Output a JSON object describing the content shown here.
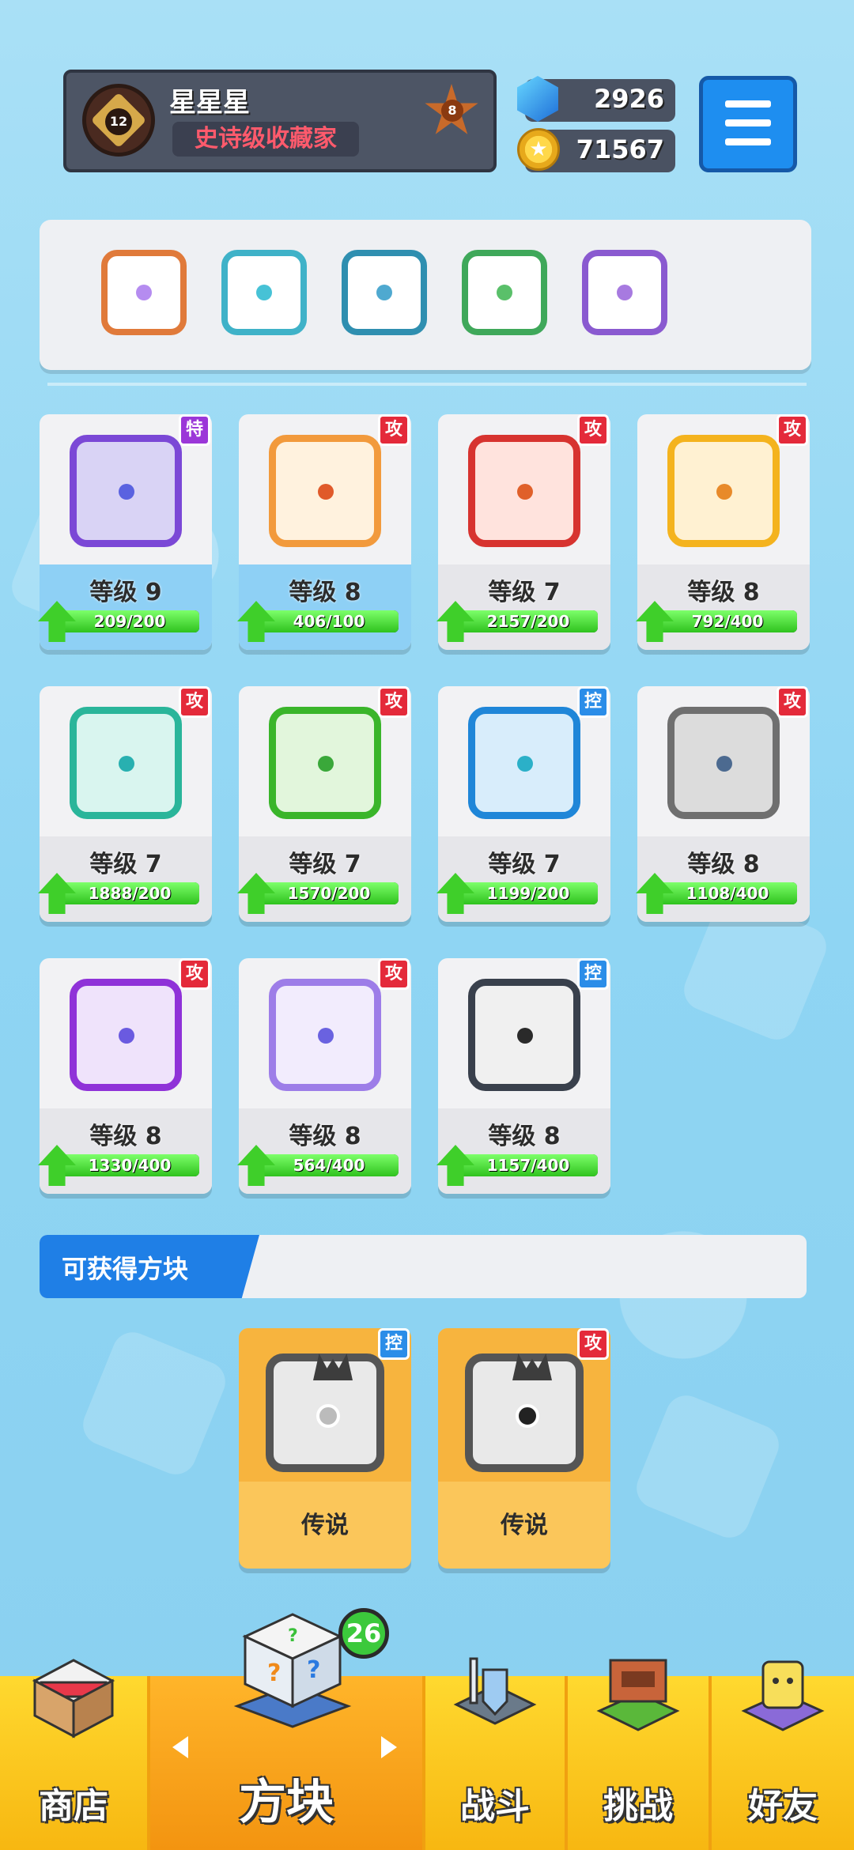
{
  "profile": {
    "name": "星星星",
    "title": "史诗级收藏家",
    "level": "12",
    "rank": "8"
  },
  "currency": {
    "gems": "2926",
    "coins": "71567"
  },
  "deck": [
    {
      "name": "rainbow",
      "border": "#e07a3a",
      "core": "#b58cf0"
    },
    {
      "name": "ice",
      "border": "#3fb2c8",
      "core": "#47c2d6"
    },
    {
      "name": "vortex",
      "border": "#2f8fb0",
      "core": "#4fa9d0"
    },
    {
      "name": "poison",
      "border": "#3fa85a",
      "core": "#5ac06a"
    },
    {
      "name": "spirit",
      "border": "#8a5ad0",
      "core": "#a77ae0"
    }
  ],
  "cards": [
    {
      "type": "特",
      "kind": "sp",
      "level": "等级 9",
      "progress": "209/200",
      "pct": 1.0,
      "border": "#7b48d6",
      "bg": "#d9d3f5",
      "dot": "#5a62e0",
      "hl": true
    },
    {
      "type": "攻",
      "kind": "atk",
      "level": "等级 8",
      "progress": "406/100",
      "pct": 1.0,
      "border": "#f29a3c",
      "bg": "#fff2de",
      "dot": "#e05a2a",
      "hl": true
    },
    {
      "type": "攻",
      "kind": "atk",
      "level": "等级 7",
      "progress": "2157/200",
      "pct": 1.0,
      "border": "#d7332f",
      "bg": "#ffe3dd",
      "dot": "#e0602a",
      "hl": false
    },
    {
      "type": "攻",
      "kind": "atk",
      "level": "等级 8",
      "progress": "792/400",
      "pct": 1.0,
      "border": "#f4b31e",
      "bg": "#fff1d2",
      "dot": "#e88a2a",
      "hl": false
    },
    {
      "type": "攻",
      "kind": "atk",
      "level": "等级 7",
      "progress": "1888/200",
      "pct": 1.0,
      "border": "#2ab59a",
      "bg": "#d9f5ef",
      "dot": "#28b0b0",
      "hl": false
    },
    {
      "type": "攻",
      "kind": "atk",
      "level": "等级 7",
      "progress": "1570/200",
      "pct": 1.0,
      "border": "#3ab52a",
      "bg": "#e2f6dc",
      "dot": "#3aa83a",
      "hl": false
    },
    {
      "type": "控",
      "kind": "ctl",
      "level": "等级 7",
      "progress": "1199/200",
      "pct": 1.0,
      "border": "#1f86d8",
      "bg": "#d8edfb",
      "dot": "#2bb0c8",
      "hl": false
    },
    {
      "type": "攻",
      "kind": "atk",
      "level": "等级 8",
      "progress": "1108/400",
      "pct": 1.0,
      "border": "#6f6f6f",
      "bg": "#dcdcdc",
      "dot": "#4c6a90",
      "hl": false
    },
    {
      "type": "攻",
      "kind": "atk",
      "level": "等级 8",
      "progress": "1330/400",
      "pct": 1.0,
      "border": "#8f32d8",
      "bg": "#efe3fb",
      "dot": "#6a5ae0",
      "hl": false
    },
    {
      "type": "攻",
      "kind": "atk",
      "level": "等级 8",
      "progress": "564/400",
      "pct": 1.0,
      "border": "#9d7de8",
      "bg": "#f2ecfd",
      "dot": "#6a62e0",
      "hl": false
    },
    {
      "type": "控",
      "kind": "ctl",
      "level": "等级 8",
      "progress": "1157/400",
      "pct": 1.0,
      "border": "#39404c",
      "bg": "#f0f0f0",
      "dot": "#2a2a2a",
      "hl": false
    }
  ],
  "obtainable": {
    "title": "可获得方块",
    "items": [
      {
        "type": "控",
        "kind": "ctl",
        "rarity": "传说"
      },
      {
        "type": "攻",
        "kind": "atk",
        "rarity": "传说"
      }
    ]
  },
  "nav": {
    "badge": "26",
    "items": [
      {
        "label": "商店"
      },
      {
        "label": "方块"
      },
      {
        "label": "战斗"
      },
      {
        "label": "挑战"
      },
      {
        "label": "好友"
      }
    ]
  }
}
